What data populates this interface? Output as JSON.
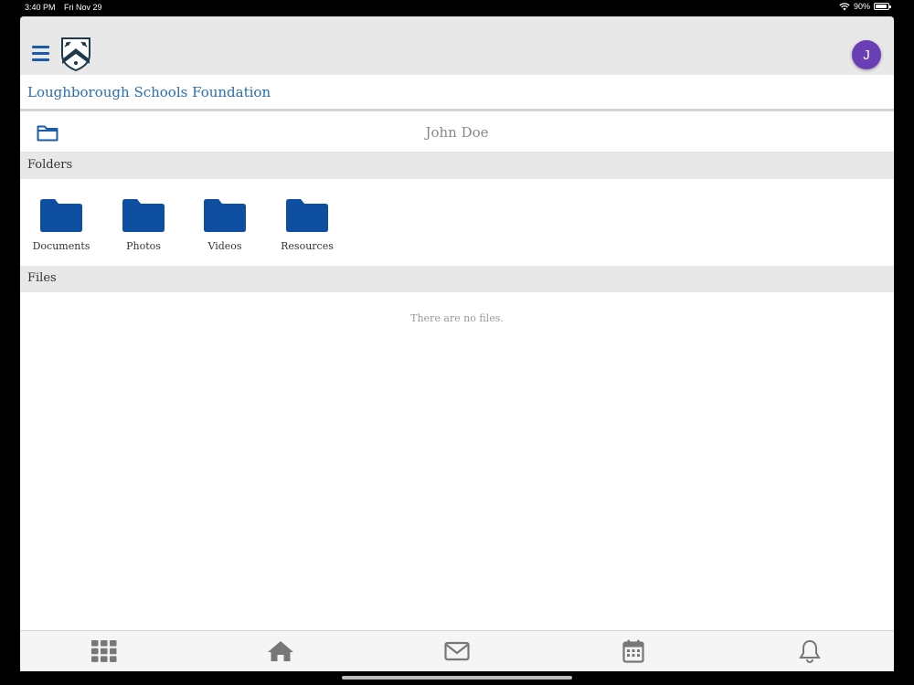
{
  "status": {
    "time": "3:40 PM",
    "date": "Fri Nov 29",
    "battery": "90%",
    "battery_level": 0.9
  },
  "header": {
    "avatar_initial": "J"
  },
  "org": {
    "name": "Loughborough Schools Foundation"
  },
  "path": {
    "owner": "John Doe"
  },
  "folders": {
    "title": "Folders",
    "items": [
      {
        "label": "Documents"
      },
      {
        "label": "Photos"
      },
      {
        "label": "Videos"
      },
      {
        "label": "Resources"
      }
    ]
  },
  "files": {
    "title": "Files",
    "empty_text": "There are no files."
  },
  "tabs": [
    {
      "icon": "grid-icon"
    },
    {
      "icon": "home-icon"
    },
    {
      "icon": "mail-icon"
    },
    {
      "icon": "calendar-icon"
    },
    {
      "icon": "bell-icon"
    }
  ],
  "colors": {
    "accent": "#1a5ca8",
    "avatar": "#6a3fb5",
    "org_text": "#2a6db5",
    "tab_icon": "#777777"
  }
}
